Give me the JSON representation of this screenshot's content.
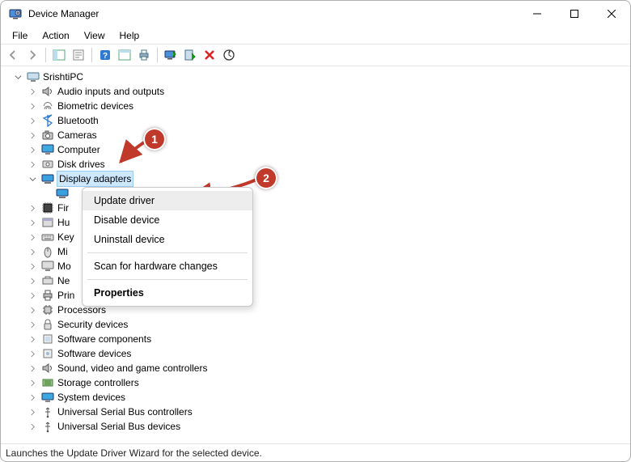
{
  "window": {
    "title": "Device Manager"
  },
  "menu": {
    "file": "File",
    "action": "Action",
    "view": "View",
    "help": "Help"
  },
  "root": {
    "label": "SrishtiPC"
  },
  "categories": {
    "audio": "Audio inputs and outputs",
    "biometric": "Biometric devices",
    "bluetooth": "Bluetooth",
    "cameras": "Cameras",
    "computer": "Computer",
    "diskdrives": "Disk drives",
    "display": "Display adapters",
    "firmware": "Fir",
    "hid": "Hu",
    "keyboards": "Key",
    "mice": "Mi",
    "monitors": "Mo",
    "network": "Ne",
    "printq": "Prin",
    "processors": "Processors",
    "security": "Security devices",
    "swcomp": "Software components",
    "swdev": "Software devices",
    "sound": "Sound, video and game controllers",
    "storage": "Storage controllers",
    "sysdev": "System devices",
    "usbctrl": "Universal Serial Bus controllers",
    "usbdev": "Universal Serial Bus devices"
  },
  "context": {
    "update": "Update driver",
    "disable": "Disable device",
    "uninstall": "Uninstall device",
    "scan": "Scan for hardware changes",
    "props": "Properties"
  },
  "callouts": {
    "one": "1",
    "two": "2"
  },
  "status": "Launches the Update Driver Wizard for the selected device."
}
